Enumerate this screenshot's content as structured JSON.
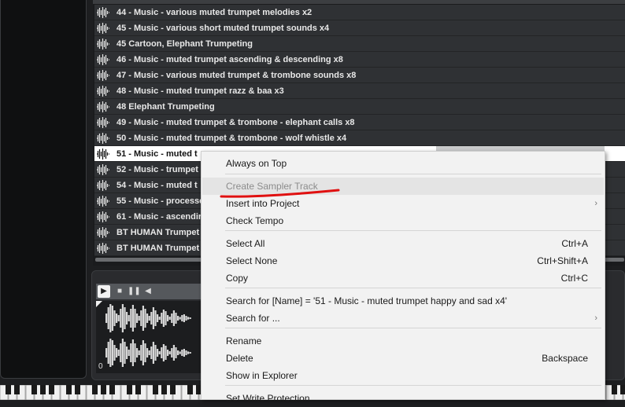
{
  "file_list": {
    "rows": [
      {
        "name": "44 - Music - various muted trumpet melodies x2"
      },
      {
        "name": "45 - Music - various short muted trumpet sounds x4"
      },
      {
        "name": "45 Cartoon, Elephant Trumpeting"
      },
      {
        "name": "46 - Music - muted trumpet ascending & descending x8"
      },
      {
        "name": "47 - Music - various muted trumpet & trombone sounds x8"
      },
      {
        "name": "48 - Music - muted trumpet razz & baa x3"
      },
      {
        "name": "48 Elephant Trumpeting"
      },
      {
        "name": "49 - Music - muted trumpet & trombone - elephant calls x8"
      },
      {
        "name": "50 - Music - muted trumpet & trombone - wolf whistle x4"
      },
      {
        "name": "51 - Music - muted t",
        "selected": true
      },
      {
        "name": "52 - Music - trumpet"
      },
      {
        "name": "54 - Music - muted t"
      },
      {
        "name": "55 - Music - processe"
      },
      {
        "name": "61 - Music - ascendir"
      },
      {
        "name": "BT HUMAN Trumpet"
      },
      {
        "name": "BT HUMAN Trumpet"
      }
    ]
  },
  "player": {
    "zero_label": "0"
  },
  "context_menu": {
    "items": [
      {
        "label": "Always on Top",
        "shortcut": "",
        "submenu": false,
        "disabled": false
      },
      {
        "label": "Create Sampler Track",
        "shortcut": "",
        "submenu": false,
        "disabled": true
      },
      {
        "label": "Insert into Project",
        "shortcut": "",
        "submenu": true,
        "disabled": false
      },
      {
        "label": "Check Tempo",
        "shortcut": "",
        "submenu": false,
        "disabled": false
      },
      {
        "label": "Select All",
        "shortcut": "Ctrl+A",
        "submenu": false,
        "disabled": false
      },
      {
        "label": "Select None",
        "shortcut": "Ctrl+Shift+A",
        "submenu": false,
        "disabled": false
      },
      {
        "label": "Copy",
        "shortcut": "Ctrl+C",
        "submenu": false,
        "disabled": false
      },
      {
        "label": "Search for [Name] = '51 - Music - muted trumpet happy and sad x4'",
        "shortcut": "",
        "submenu": false,
        "disabled": false
      },
      {
        "label": "Search for ...",
        "shortcut": "",
        "submenu": true,
        "disabled": false
      },
      {
        "label": "Rename",
        "shortcut": "",
        "submenu": false,
        "disabled": false
      },
      {
        "label": "Delete",
        "shortcut": "Backspace",
        "submenu": false,
        "disabled": false
      },
      {
        "label": "Show in Explorer",
        "shortcut": "",
        "submenu": false,
        "disabled": false
      },
      {
        "label": "Set Write Protection",
        "shortcut": "",
        "submenu": false,
        "disabled": false
      }
    ]
  },
  "icons": {
    "row_icon": "waveform-icon",
    "play": "play-icon",
    "stop": "stop-icon",
    "pause": "pause-icon",
    "volume": "volume-icon",
    "submenu": "chevron-right-icon"
  },
  "colors": {
    "annotation": "#e01010"
  }
}
